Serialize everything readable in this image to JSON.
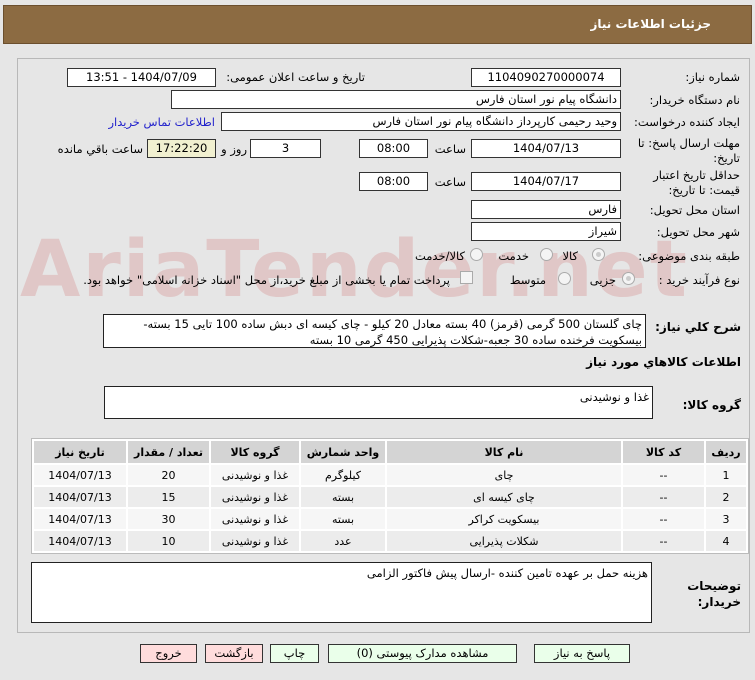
{
  "header": {
    "title": "جزئیات اطلاعات نیاز"
  },
  "watermark": "AriaTender.net",
  "form": {
    "need_number_label": "شماره نیاز:",
    "need_number": "1104090270000074",
    "announce_label": "تاریخ و ساعت اعلان عمومی:",
    "announce_value": "1404/07/09 - 13:51",
    "buyer_label": "نام دستگاه خریدار:",
    "buyer": "دانشگاه پیام نور استان فارس",
    "creator_label": "ایجاد کننده درخواست:",
    "creator": "وحید رحیمی کارپرداز دانشگاه پیام نور استان فارس",
    "contact_link": "اطلاعات تماس خریدار",
    "deadline_label": "مهلت ارسال پاسخ: تا تاریخ:",
    "deadline_date": "1404/07/13",
    "time_label": "ساعت",
    "deadline_time": "08:00",
    "days": "3",
    "days_label": "روز و",
    "remaining": "17:22:20",
    "remaining_label": "ساعت باقي مانده",
    "validity_label": "حداقل تاریخ اعتبار قیمت: تا تاریخ:",
    "validity_date": "1404/07/17",
    "validity_time": "08:00",
    "province_label": "استان محل تحویل:",
    "province": "فارس",
    "city_label": "شهر محل تحویل:",
    "city": "شیراز",
    "category_label": "طبقه بندی موضوعی:",
    "category_options": [
      "کالا",
      "خدمت",
      "کالا/خدمت"
    ],
    "category_selected": "کالا",
    "process_label": "نوع فرآیند خرید :",
    "process_options": [
      "جزیی",
      "متوسط"
    ],
    "process_selected": "جزیی",
    "payment_note": "پرداخت تمام یا بخشی از مبلغ خرید،از محل \"اسناد خزانه اسلامی\" خواهد بود.",
    "desc_label": "شرح کلي نیاز:",
    "desc": "چای گلستان 500 گرمی (قرمز) 40 بسته معادل 20 کیلو - چای کیسه ای دبش ساده  100 تایی 15 بسته-بیسکویت فرخنده ساده 30 جعبه-شکلات پذیرایی 450 گرمی 10 بسته",
    "items_title": "اطلاعات کالاهاي مورد نیاز",
    "group_label": "گروه کالا:",
    "group": "غذا و نوشیدنی",
    "notes_label": "توضیحات خریدار:",
    "notes": "هزینه حمل بر عهده تامین کننده -ارسال پیش فاکتور الزامی"
  },
  "table": {
    "headers": [
      "ردیف",
      "کد کالا",
      "نام کالا",
      "واحد شمارش",
      "گروه کالا",
      "تعداد / مقدار",
      "تاریخ نیاز"
    ],
    "rows": [
      [
        "1",
        "--",
        "چای",
        "کیلوگرم",
        "غذا و نوشیدنی",
        "20",
        "1404/07/13"
      ],
      [
        "2",
        "--",
        "چای کیسه ای",
        "بسته",
        "غذا و نوشیدنی",
        "15",
        "1404/07/13"
      ],
      [
        "3",
        "--",
        "بیسکویت کراکر",
        "بسته",
        "غذا و نوشیدنی",
        "30",
        "1404/07/13"
      ],
      [
        "4",
        "--",
        "شکلات پذیرایی",
        "عدد",
        "غذا و نوشیدنی",
        "10",
        "1404/07/13"
      ]
    ]
  },
  "buttons": {
    "reply": "پاسخ به نیاز",
    "attachments": "مشاهده مدارک پیوستی (0)",
    "print": "چاپ",
    "back": "بازگشت",
    "exit": "خروج"
  }
}
